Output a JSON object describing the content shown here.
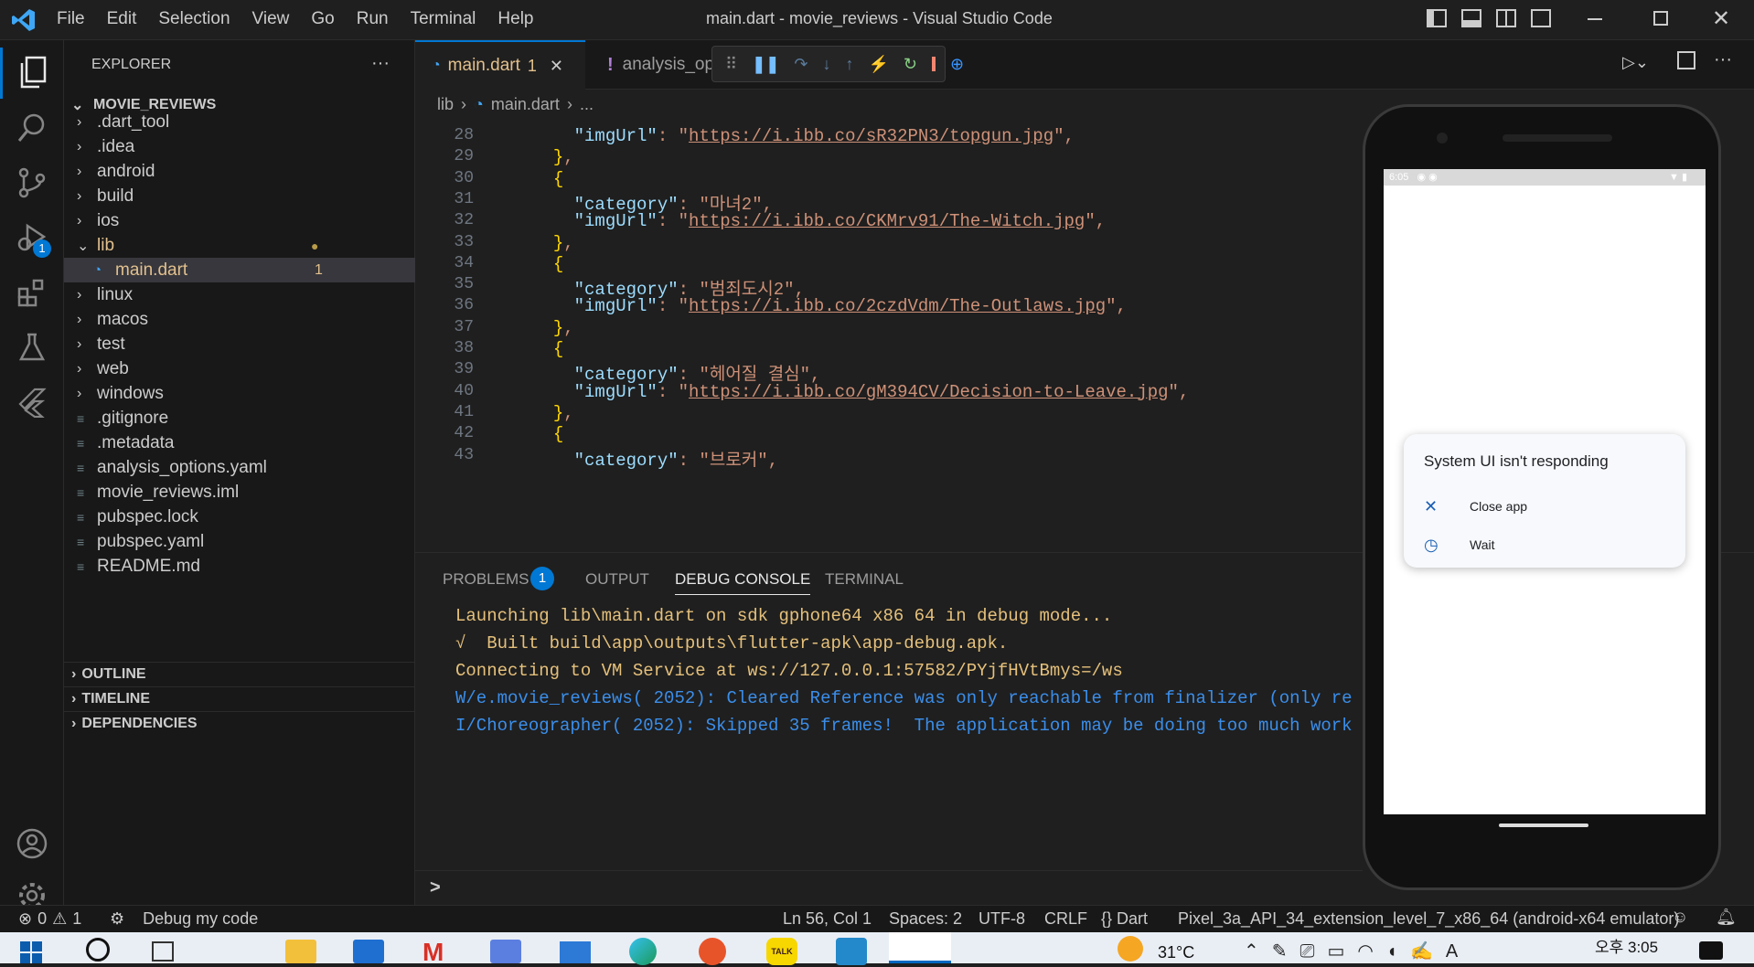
{
  "titlebar": {
    "menus": [
      "File",
      "Edit",
      "Selection",
      "View",
      "Go",
      "Run",
      "Terminal",
      "Help"
    ],
    "title": "main.dart - movie_reviews - Visual Studio Code"
  },
  "activity": {
    "debug_badge": "1"
  },
  "explorer": {
    "header": "EXPLORER",
    "more": "···",
    "root": "MOVIE_REVIEWS",
    "items": [
      {
        "label": ".dart_tool",
        "type": "folder"
      },
      {
        "label": ".idea",
        "type": "folder"
      },
      {
        "label": "android",
        "type": "folder"
      },
      {
        "label": "build",
        "type": "folder"
      },
      {
        "label": "ios",
        "type": "folder"
      },
      {
        "label": "lib",
        "type": "folder-open"
      },
      {
        "label": "main.dart",
        "type": "file-active",
        "badge": "1"
      },
      {
        "label": "linux",
        "type": "folder"
      },
      {
        "label": "macos",
        "type": "folder"
      },
      {
        "label": "test",
        "type": "folder"
      },
      {
        "label": "web",
        "type": "folder"
      },
      {
        "label": "windows",
        "type": "folder"
      },
      {
        "label": ".gitignore",
        "type": "file"
      },
      {
        "label": ".metadata",
        "type": "file"
      },
      {
        "label": "analysis_options.yaml",
        "type": "file"
      },
      {
        "label": "movie_reviews.iml",
        "type": "file"
      },
      {
        "label": "pubspec.lock",
        "type": "file"
      },
      {
        "label": "pubspec.yaml",
        "type": "file"
      },
      {
        "label": "README.md",
        "type": "file"
      }
    ],
    "sections": [
      "OUTLINE",
      "TIMELINE",
      "DEPENDENCIES"
    ]
  },
  "tabs": [
    {
      "label": "main.dart",
      "badge": "1",
      "close": "✕"
    },
    {
      "label": "analysis_op"
    }
  ],
  "breadcrumb": {
    "lib": "lib",
    "file": "main.dart",
    "more": "..."
  },
  "code": {
    "lines": [
      {
        "n": "28",
        "t": "    \"imgUrl\": \"https://i.ibb.co/sR32PN3/topgun.jpg\","
      },
      {
        "n": "29",
        "t": "  },"
      },
      {
        "n": "30",
        "t": "  {"
      },
      {
        "n": "31",
        "t": "    \"category\": \"마녀2\","
      },
      {
        "n": "32",
        "t": "    \"imgUrl\": \"https://i.ibb.co/CKMrv91/The-Witch.jpg\","
      },
      {
        "n": "33",
        "t": "  },"
      },
      {
        "n": "34",
        "t": "  {"
      },
      {
        "n": "35",
        "t": "    \"category\": \"범죄도시2\","
      },
      {
        "n": "36",
        "t": "    \"imgUrl\": \"https://i.ibb.co/2czdVdm/The-Outlaws.jpg\","
      },
      {
        "n": "37",
        "t": "  },"
      },
      {
        "n": "38",
        "t": "  {"
      },
      {
        "n": "39",
        "t": "    \"category\": \"헤어질 결심\","
      },
      {
        "n": "40",
        "t": "    \"imgUrl\": \"https://i.ibb.co/gM394CV/Decision-to-Leave.jpg\","
      },
      {
        "n": "41",
        "t": "  },"
      },
      {
        "n": "42",
        "t": "  {"
      },
      {
        "n": "43",
        "t": "    \"category\": \"브로커\","
      }
    ]
  },
  "panel": {
    "tabs": [
      "PROBLEMS",
      "OUTPUT",
      "DEBUG CONSOLE",
      "TERMINAL"
    ],
    "problems_badge": "1",
    "console": [
      {
        "t": "Launching lib\\main.dart on sdk gphone64 x86 64 in debug mode...",
        "c": "#e5c07b"
      },
      {
        "t": "√  Built build\\app\\outputs\\flutter-apk\\app-debug.apk.",
        "c": "#e5c07b"
      },
      {
        "t": "Connecting to VM Service at ws://127.0.0.1:57582/PYjfHVtBmys=/ws",
        "c": "#e5c07b"
      },
      {
        "t": "W/e.movie_reviews( 2052): Cleared Reference was only reachable from finalizer (only re",
        "c": "#3b8eea"
      },
      {
        "t": "I/Choreographer( 2052): Skipped 35 frames!  The application may be doing too much work",
        "c": "#3b8eea"
      }
    ],
    "prompt": ">"
  },
  "phone": {
    "status_time": "6:05",
    "dialog_title": "System UI isn't responding",
    "close_app": "Close app",
    "wait": "Wait"
  },
  "status": {
    "errors": "0",
    "warnings": "1",
    "debug": "Debug my code",
    "position": "Ln 56, Col 1",
    "spaces": "Spaces: 2",
    "encoding": "UTF-8",
    "eol": "CRLF",
    "lang": "{} Dart",
    "device": "Pixel_3a_API_34_extension_level_7_x86_64 (android-x64 emulator)"
  },
  "taskbar": {
    "weather": "31°C",
    "time": "오후 3:05"
  }
}
